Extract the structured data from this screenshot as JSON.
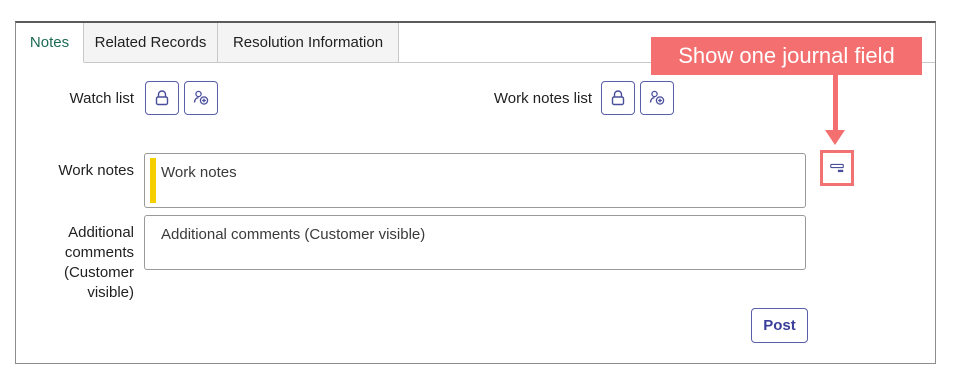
{
  "tabs": [
    {
      "label": "Notes",
      "active": true
    },
    {
      "label": "Related Records",
      "active": false
    },
    {
      "label": "Resolution Information",
      "active": false
    }
  ],
  "fields": {
    "watch_list_label": "Watch list",
    "work_notes_list_label": "Work notes list",
    "work_notes_label": "Work notes",
    "work_notes_placeholder": "Work notes",
    "additional_comments_label_lines": [
      "Additional",
      "comments",
      "(Customer",
      "visible)"
    ],
    "additional_comments_placeholder": "Additional comments (Customer visible)"
  },
  "actions": {
    "post_label": "Post"
  },
  "annotation": {
    "callout_text": "Show one journal field"
  },
  "icons": {
    "lock": "lock-icon",
    "add_user": "add-user-icon",
    "single_field": "single-journal-field-icon"
  },
  "colors": {
    "active_tab_text": "#1d6b55",
    "button_border": "#5a60a8",
    "work_notes_bar": "#f5cf00",
    "callout": "#f46f6f"
  }
}
